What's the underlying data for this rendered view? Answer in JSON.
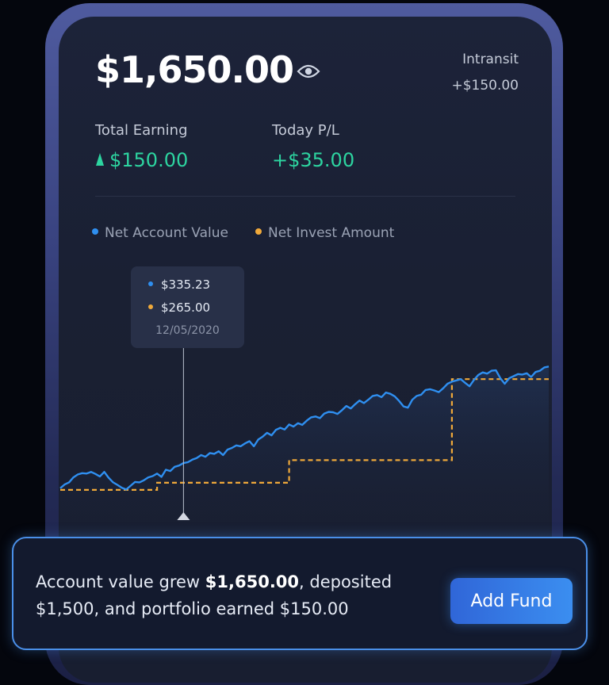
{
  "account": {
    "balance": "$1,650.00",
    "intransit_label": "Intransit",
    "intransit_value": "+$150.00"
  },
  "stats": {
    "total_earning_label": "Total Earning",
    "total_earning_value": "$150.00",
    "today_pl_label": "Today P/L",
    "today_pl_value": "+$35.00"
  },
  "legend": {
    "net_account_value": "Net Account Value",
    "net_invest_amount": "Net Invest Amount"
  },
  "tooltip": {
    "account_value": "$335.23",
    "invest_amount": "$265.00",
    "date": "12/05/2020"
  },
  "colors": {
    "accent_blue": "#2f8ff0",
    "accent_orange": "#f0a93a",
    "positive_green": "#2dd4a0"
  },
  "chart_data": {
    "type": "line",
    "title": "",
    "xlabel": "",
    "ylabel": "",
    "ylim": [
      0,
      1700
    ],
    "grid": false,
    "legend_placement": "top-left",
    "series": [
      {
        "name": "Net Account Value",
        "values": [
          200,
          245,
          270,
          330,
          365,
          380,
          375,
          395,
          370,
          340,
          395,
          325,
          270,
          240,
          205,
          185,
          230,
          275,
          270,
          295,
          330,
          345,
          375,
          335,
          420,
          405,
          455,
          470,
          500,
          510,
          540,
          560,
          595,
          575,
          620,
          610,
          640,
          595,
          660,
          680,
          710,
          700,
          735,
          760,
          700,
          780,
          815,
          860,
          830,
          895,
          920,
          900,
          960,
          935,
          975,
          955,
          1005,
          1045,
          1055,
          1035,
          1090,
          1110,
          1105,
          1085,
          1130,
          1180,
          1150,
          1200,
          1245,
          1215,
          1255,
          1300,
          1310,
          1285,
          1340,
          1325,
          1295,
          1240,
          1175,
          1160,
          1255,
          1300,
          1315,
          1370,
          1380,
          1365,
          1345,
          1390,
          1445,
          1470,
          1485,
          1500,
          1455,
          1415,
          1490,
          1550,
          1580,
          1565,
          1600,
          1605,
          1510,
          1445,
          1510,
          1535,
          1560,
          1555,
          1570,
          1525,
          1585,
          1600,
          1640,
          1650
        ]
      },
      {
        "name": "Net Invest Amount",
        "values": [
          180,
          180,
          180,
          180,
          180,
          180,
          180,
          180,
          180,
          180,
          180,
          180,
          180,
          180,
          180,
          180,
          180,
          180,
          180,
          180,
          180,
          180,
          265,
          265,
          265,
          265,
          265,
          265,
          265,
          265,
          265,
          265,
          265,
          265,
          265,
          265,
          265,
          265,
          265,
          265,
          265,
          265,
          265,
          265,
          265,
          265,
          265,
          265,
          265,
          265,
          265,
          265,
          535,
          535,
          535,
          535,
          535,
          535,
          535,
          535,
          535,
          535,
          535,
          535,
          535,
          535,
          535,
          535,
          535,
          535,
          535,
          535,
          535,
          535,
          535,
          535,
          535,
          535,
          535,
          535,
          535,
          535,
          535,
          535,
          535,
          535,
          535,
          535,
          535,
          1500,
          1500,
          1500,
          1500,
          1500,
          1500,
          1500,
          1500,
          1500,
          1500,
          1500,
          1500,
          1500,
          1500,
          1500,
          1500,
          1500,
          1500,
          1500,
          1500,
          1500,
          1500,
          1500
        ]
      }
    ],
    "highlight_index": 28
  },
  "banner": {
    "text_before": "Account value grew ",
    "text_amount": "$1,650.00",
    "text_after": ", deposited $1,500, and portfolio earned $150.00",
    "button_label": "Add Fund"
  }
}
